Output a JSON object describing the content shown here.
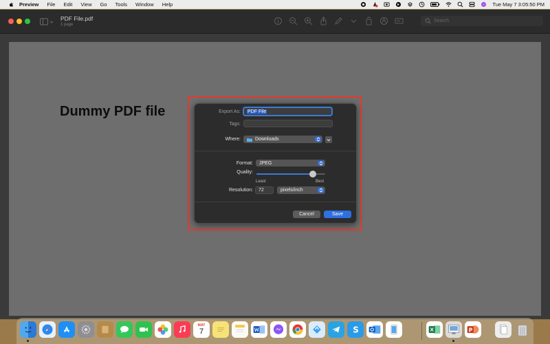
{
  "menubar": {
    "app": "Preview",
    "items": [
      "File",
      "Edit",
      "View",
      "Go",
      "Tools",
      "Window",
      "Help"
    ],
    "datetime": "Tue May 7  3:05:50 PM"
  },
  "window": {
    "title": "PDF File.pdf",
    "subtitle": "1 page",
    "search_placeholder": "Search"
  },
  "document": {
    "heading": "Dummy PDF file"
  },
  "dialog": {
    "export_as_label": "Export As:",
    "export_as_value": "PDF File",
    "tags_label": "Tags:",
    "tags_value": "",
    "where_label": "Where:",
    "where_value": "Downloads",
    "format_label": "Format:",
    "format_value": "JPEG",
    "quality_label": "Quality:",
    "quality_level": 0.82,
    "quality_min_label": "Least",
    "quality_max_label": "Best",
    "resolution_label": "Resolution:",
    "resolution_value": "72",
    "resolution_unit": "pixels/inch",
    "cancel_label": "Cancel",
    "save_label": "Save"
  },
  "dock": {
    "calendar_month": "MAY",
    "calendar_day": "7",
    "apps": [
      "finder",
      "safari",
      "app-store",
      "system-settings",
      "notes-app",
      "messages",
      "facetime",
      "photos",
      "music",
      "calendar",
      "stickies",
      "notes",
      "word",
      "messenger",
      "chrome",
      "maps-app",
      "telegram",
      "skype",
      "outlook",
      "excel",
      "preview",
      "powerpoint",
      "documents",
      "trash"
    ]
  }
}
